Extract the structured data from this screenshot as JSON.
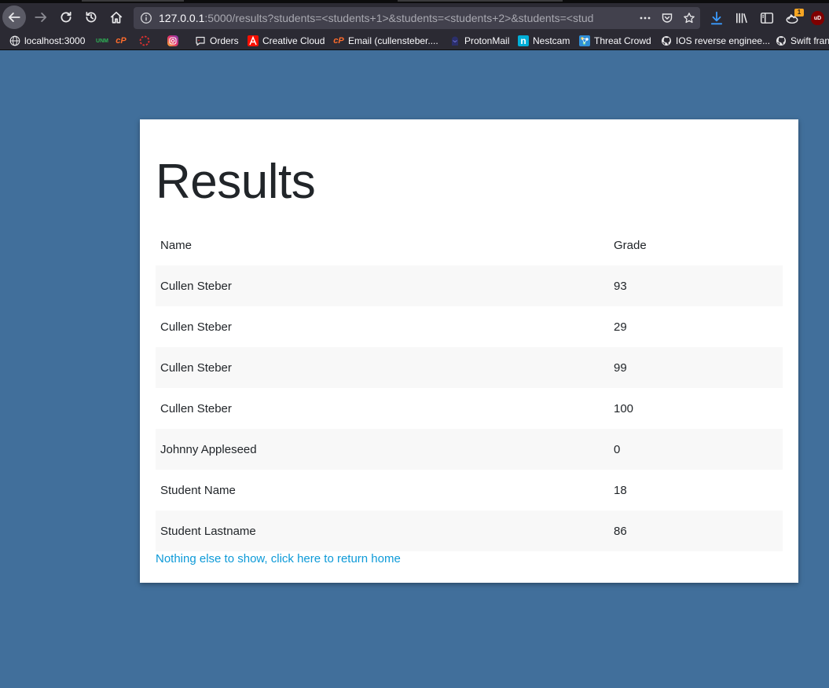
{
  "browser": {
    "url_host": "127.0.0.1",
    "url_rest": ":5000/results?students=<students+1>&students=<students+2>&students=<stud",
    "download_badge": "1",
    "ublock_label": "uD",
    "bookmarks": [
      {
        "label": "localhost:3000",
        "icon": "globe-icon"
      },
      {
        "label": "",
        "icon": "unm-icon",
        "glyph": "UNM"
      },
      {
        "label": "",
        "icon": "cpanel-icon",
        "glyph": "cP"
      },
      {
        "label": "",
        "icon": "dashed-circle-icon"
      },
      {
        "label": "",
        "icon": "instagram-icon"
      },
      {
        "label": "Orders",
        "icon": "chat-bubble-icon"
      },
      {
        "label": "Creative Cloud",
        "icon": "adobe-icon"
      },
      {
        "label": "Email (cullensteber....",
        "icon": "cpanel-icon",
        "glyph": "cP"
      },
      {
        "label": "ProtonMail",
        "icon": "protonmail-icon"
      },
      {
        "label": "Nestcam",
        "icon": "nest-icon",
        "glyph": "n"
      },
      {
        "label": "Threat Crowd",
        "icon": "threatcrowd-icon"
      },
      {
        "label": "IOS reverse enginee...",
        "icon": "github-icon"
      },
      {
        "label": "Swift fran",
        "icon": "github-icon"
      }
    ]
  },
  "page": {
    "title": "Results",
    "table": {
      "headers": [
        "Name",
        "Grade"
      ],
      "rows": [
        [
          "Cullen Steber",
          "93"
        ],
        [
          "Cullen Steber",
          "29"
        ],
        [
          "Cullen Steber",
          "99"
        ],
        [
          "Cullen Steber",
          "100"
        ],
        [
          "Johnny Appleseed",
          "0"
        ],
        [
          "Student Name",
          "18"
        ],
        [
          "Student Lastname",
          "86"
        ]
      ]
    },
    "home_link": "Nothing else to show, click here to return home"
  },
  "colors": {
    "background": "#416f9b",
    "link": "#0d9ad8",
    "stripe": "#f8f8f8"
  }
}
